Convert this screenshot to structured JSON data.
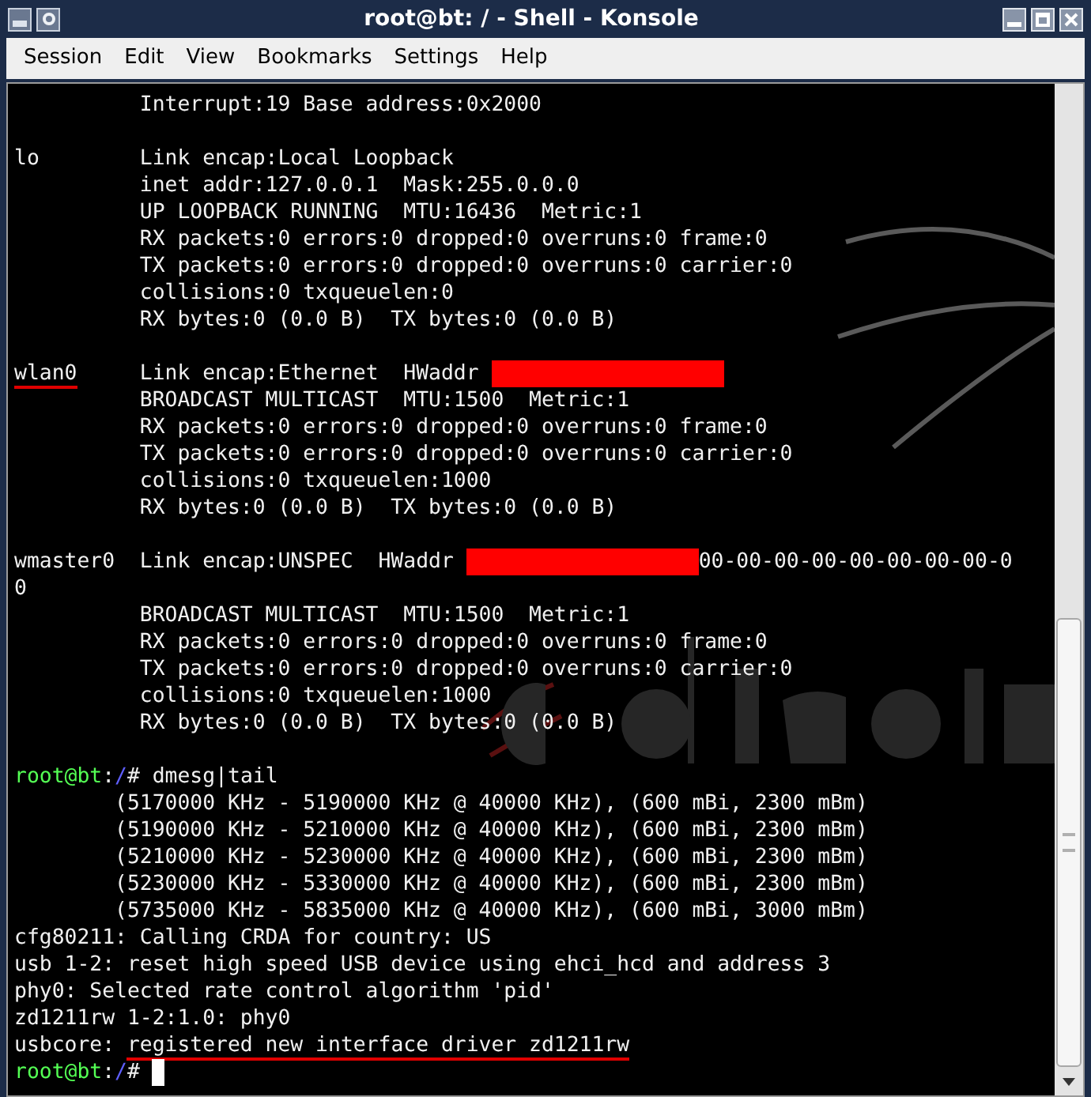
{
  "window": {
    "title": "root@bt: / - Shell - Konsole"
  },
  "menu": [
    {
      "label": "Session"
    },
    {
      "label": "Edit"
    },
    {
      "label": "View"
    },
    {
      "label": "Bookmarks"
    },
    {
      "label": "Settings"
    },
    {
      "label": "Help"
    }
  ],
  "terminal": {
    "lines": [
      {
        "kind": "text",
        "segments": [
          {
            "kind": "plain",
            "text": "          Interrupt:19 Base address:0x2000"
          }
        ]
      },
      {
        "kind": "blank"
      },
      {
        "kind": "text",
        "segments": [
          {
            "kind": "plain",
            "text": "lo        Link encap:Local Loopback"
          }
        ]
      },
      {
        "kind": "text",
        "segments": [
          {
            "kind": "plain",
            "text": "          inet addr:127.0.0.1  Mask:255.0.0.0"
          }
        ]
      },
      {
        "kind": "text",
        "segments": [
          {
            "kind": "plain",
            "text": "          UP LOOPBACK RUNNING  MTU:16436  Metric:1"
          }
        ]
      },
      {
        "kind": "text",
        "segments": [
          {
            "kind": "plain",
            "text": "          RX packets:0 errors:0 dropped:0 overruns:0 frame:0"
          }
        ]
      },
      {
        "kind": "text",
        "segments": [
          {
            "kind": "plain",
            "text": "          TX packets:0 errors:0 dropped:0 overruns:0 carrier:0"
          }
        ]
      },
      {
        "kind": "text",
        "segments": [
          {
            "kind": "plain",
            "text": "          collisions:0 txqueuelen:0"
          }
        ]
      },
      {
        "kind": "text",
        "segments": [
          {
            "kind": "plain",
            "text": "          RX bytes:0 (0.0 B)  TX bytes:0 (0.0 B)"
          }
        ]
      },
      {
        "kind": "blank"
      },
      {
        "kind": "text",
        "segments": [
          {
            "kind": "underline",
            "text": "wlan0"
          },
          {
            "kind": "plain",
            "text": "     Link encap:Ethernet  HWaddr "
          },
          {
            "kind": "redacted"
          }
        ]
      },
      {
        "kind": "text",
        "segments": [
          {
            "kind": "plain",
            "text": "          BROADCAST MULTICAST  MTU:1500  Metric:1"
          }
        ]
      },
      {
        "kind": "text",
        "segments": [
          {
            "kind": "plain",
            "text": "          RX packets:0 errors:0 dropped:0 overruns:0 frame:0"
          }
        ]
      },
      {
        "kind": "text",
        "segments": [
          {
            "kind": "plain",
            "text": "          TX packets:0 errors:0 dropped:0 overruns:0 carrier:0"
          }
        ]
      },
      {
        "kind": "text",
        "segments": [
          {
            "kind": "plain",
            "text": "          collisions:0 txqueuelen:1000"
          }
        ]
      },
      {
        "kind": "text",
        "segments": [
          {
            "kind": "plain",
            "text": "          RX bytes:0 (0.0 B)  TX bytes:0 (0.0 B)"
          }
        ]
      },
      {
        "kind": "blank"
      },
      {
        "kind": "text",
        "segments": [
          {
            "kind": "plain",
            "text": "wmaster0  Link encap:UNSPEC  HWaddr "
          },
          {
            "kind": "redacted"
          },
          {
            "kind": "plain",
            "text": "00-00-00-00-00-00-00-00-0"
          }
        ]
      },
      {
        "kind": "text",
        "segments": [
          {
            "kind": "plain",
            "text": "0"
          }
        ]
      },
      {
        "kind": "text",
        "segments": [
          {
            "kind": "plain",
            "text": "          BROADCAST MULTICAST  MTU:1500  Metric:1"
          }
        ]
      },
      {
        "kind": "text",
        "segments": [
          {
            "kind": "plain",
            "text": "          RX packets:0 errors:0 dropped:0 overruns:0 frame:0"
          }
        ]
      },
      {
        "kind": "text",
        "segments": [
          {
            "kind": "plain",
            "text": "          TX packets:0 errors:0 dropped:0 overruns:0 carrier:0"
          }
        ]
      },
      {
        "kind": "text",
        "segments": [
          {
            "kind": "plain",
            "text": "          collisions:0 txqueuelen:1000"
          }
        ]
      },
      {
        "kind": "text",
        "segments": [
          {
            "kind": "plain",
            "text": "          RX bytes:0 (0.0 B)  TX bytes:0 (0.0 B)"
          }
        ]
      },
      {
        "kind": "blank"
      },
      {
        "kind": "text",
        "segments": [
          {
            "kind": "user",
            "text": "root@bt"
          },
          {
            "kind": "plain",
            "text": ":"
          },
          {
            "kind": "path",
            "text": "/"
          },
          {
            "kind": "plain",
            "text": "# dmesg|tail"
          }
        ]
      },
      {
        "kind": "text",
        "segments": [
          {
            "kind": "plain",
            "text": "        (5170000 KHz - 5190000 KHz @ 40000 KHz), (600 mBi, 2300 mBm)"
          }
        ]
      },
      {
        "kind": "text",
        "segments": [
          {
            "kind": "plain",
            "text": "        (5190000 KHz - 5210000 KHz @ 40000 KHz), (600 mBi, 2300 mBm)"
          }
        ]
      },
      {
        "kind": "text",
        "segments": [
          {
            "kind": "plain",
            "text": "        (5210000 KHz - 5230000 KHz @ 40000 KHz), (600 mBi, 2300 mBm)"
          }
        ]
      },
      {
        "kind": "text",
        "segments": [
          {
            "kind": "plain",
            "text": "        (5230000 KHz - 5330000 KHz @ 40000 KHz), (600 mBi, 2300 mBm)"
          }
        ]
      },
      {
        "kind": "text",
        "segments": [
          {
            "kind": "plain",
            "text": "        (5735000 KHz - 5835000 KHz @ 40000 KHz), (600 mBi, 3000 mBm)"
          }
        ]
      },
      {
        "kind": "text",
        "segments": [
          {
            "kind": "plain",
            "text": "cfg80211: Calling CRDA for country: US"
          }
        ]
      },
      {
        "kind": "text",
        "segments": [
          {
            "kind": "plain",
            "text": "usb 1-2: reset high speed USB device using ehci_hcd and address 3"
          }
        ]
      },
      {
        "kind": "text",
        "segments": [
          {
            "kind": "plain",
            "text": "phy0: Selected rate control algorithm 'pid'"
          }
        ]
      },
      {
        "kind": "text",
        "segments": [
          {
            "kind": "plain",
            "text": "zd1211rw 1-2:1.0: phy0"
          }
        ]
      },
      {
        "kind": "text",
        "segments": [
          {
            "kind": "plain",
            "text": "usbcore: "
          },
          {
            "kind": "underline",
            "text": "registered new interface driver zd1211rw"
          }
        ]
      },
      {
        "kind": "text",
        "segments": [
          {
            "kind": "user",
            "text": "root@bt"
          },
          {
            "kind": "plain",
            "text": ":"
          },
          {
            "kind": "path",
            "text": "/"
          },
          {
            "kind": "plain",
            "text": "# "
          },
          {
            "kind": "cursor"
          }
        ]
      }
    ]
  }
}
